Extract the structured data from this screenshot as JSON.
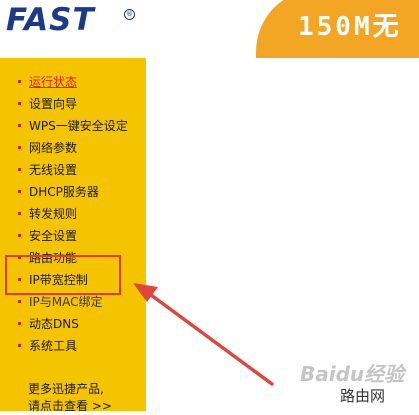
{
  "header": {
    "logo": "FAST",
    "logo_mark": "®",
    "title": "150M无"
  },
  "sidebar": {
    "items": [
      {
        "label": "运行状态",
        "active": true
      },
      {
        "label": "设置向导"
      },
      {
        "label": "WPS一键安全设定"
      },
      {
        "label": "网络参数"
      },
      {
        "label": "无线设置"
      },
      {
        "label": "DHCP服务器"
      },
      {
        "label": "转发规则"
      },
      {
        "label": "安全设置"
      },
      {
        "label": "路由功能"
      },
      {
        "label": "IP带宽控制",
        "highlighted": true
      },
      {
        "label": "IP与MAC绑定"
      },
      {
        "label": "动态DNS"
      },
      {
        "label": "系统工具"
      }
    ],
    "promo_line1": "更多迅捷产品,",
    "promo_line2": "请点击查看 >>"
  },
  "annotation": {
    "arrow_color": "#e0463b",
    "box_color": "#e23a31"
  },
  "watermark": {
    "text": "Baidu经验",
    "site": "路由网"
  },
  "colors": {
    "sidebar_bg": "#f5c400",
    "banner_bg": "#f3a623",
    "logo_blue": "#1a3a8a",
    "active_red": "#d7261e"
  }
}
